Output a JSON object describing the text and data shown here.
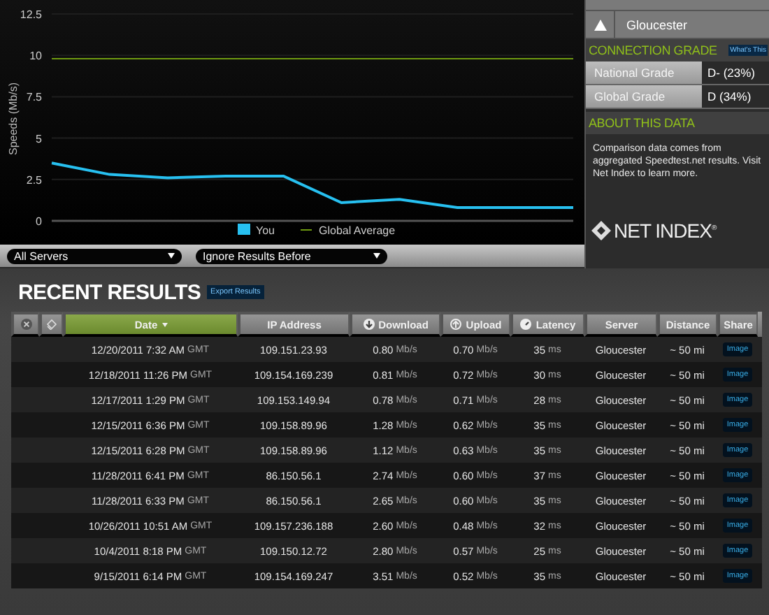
{
  "chart": {
    "chart_data": {
      "type": "line",
      "ylabel": "Speeds (Mb/s)",
      "yticks": [
        0,
        2.5,
        5,
        7.5,
        10,
        12.5
      ],
      "ylim": [
        0,
        12.5
      ],
      "grid": true,
      "legend": true,
      "series": [
        {
          "name": "You",
          "color": "#27c0f0",
          "values": [
            3.5,
            2.8,
            2.6,
            2.7,
            2.7,
            1.1,
            1.3,
            0.8,
            0.8,
            0.8
          ]
        },
        {
          "name": "Global Average",
          "color": "#6e9a10",
          "values": [
            9.8,
            9.8,
            9.8,
            9.8,
            9.8,
            9.8,
            9.8,
            9.8,
            9.8,
            9.8
          ]
        }
      ]
    }
  },
  "filters": [
    {
      "value": "All Servers"
    },
    {
      "value": "Ignore Results Before"
    }
  ],
  "side_panel": {
    "server": "Gloucester",
    "connection_grade": {
      "title": "CONNECTION GRADE",
      "help": "What's This",
      "grades": [
        {
          "label": "National Grade",
          "value": "D- (23%)"
        },
        {
          "label": "Global Grade",
          "value": "D (34%)"
        }
      ]
    },
    "about": {
      "title": "ABOUT THIS DATA",
      "text": "Comparison data comes from aggregated Speedtest.net results. Visit Net Index to learn more."
    },
    "logo": {
      "text": "NET INDEX",
      "mark": "®"
    }
  },
  "recent_results": {
    "title": "RECENT RESULTS",
    "export": "Export Results",
    "columns": [
      {
        "kind": "delete",
        "selected": false
      },
      {
        "kind": "tag",
        "selected": false
      },
      {
        "kind": "sort",
        "label": "Date",
        "selected": true
      },
      {
        "kind": "text",
        "label": "IP Address",
        "selected": false
      },
      {
        "kind": "download",
        "label": "Download",
        "selected": false
      },
      {
        "kind": "upload",
        "label": "Upload",
        "selected": false
      },
      {
        "kind": "latency",
        "label": "Latency",
        "selected": false
      },
      {
        "kind": "text",
        "label": "Server",
        "selected": false
      },
      {
        "kind": "text",
        "label": "Distance",
        "selected": false
      },
      {
        "kind": "text",
        "label": "Share",
        "selected": false
      }
    ],
    "rows": [
      {
        "date": "12/20/2011 7:32 AM",
        "zone": "GMT",
        "ip": "109.151.23.93",
        "download": "0.80",
        "download_unit": "Mb/s",
        "upload": "0.70",
        "upload_unit": "Mb/s",
        "latency": "35",
        "latency_unit": "ms",
        "server": "Gloucester",
        "distance": "~ 50 mi",
        "share": "Image"
      },
      {
        "date": "12/18/2011 11:26 PM",
        "zone": "GMT",
        "ip": "109.154.169.239",
        "download": "0.81",
        "download_unit": "Mb/s",
        "upload": "0.72",
        "upload_unit": "Mb/s",
        "latency": "30",
        "latency_unit": "ms",
        "server": "Gloucester",
        "distance": "~ 50 mi",
        "share": "Image"
      },
      {
        "date": "12/17/2011 1:29 PM",
        "zone": "GMT",
        "ip": "109.153.149.94",
        "download": "0.78",
        "download_unit": "Mb/s",
        "upload": "0.71",
        "upload_unit": "Mb/s",
        "latency": "28",
        "latency_unit": "ms",
        "server": "Gloucester",
        "distance": "~ 50 mi",
        "share": "Image"
      },
      {
        "date": "12/15/2011 6:36 PM",
        "zone": "GMT",
        "ip": "109.158.89.96",
        "download": "1.28",
        "download_unit": "Mb/s",
        "upload": "0.62",
        "upload_unit": "Mb/s",
        "latency": "35",
        "latency_unit": "ms",
        "server": "Gloucester",
        "distance": "~ 50 mi",
        "share": "Image"
      },
      {
        "date": "12/15/2011 6:28 PM",
        "zone": "GMT",
        "ip": "109.158.89.96",
        "download": "1.12",
        "download_unit": "Mb/s",
        "upload": "0.63",
        "upload_unit": "Mb/s",
        "latency": "35",
        "latency_unit": "ms",
        "server": "Gloucester",
        "distance": "~ 50 mi",
        "share": "Image"
      },
      {
        "date": "11/28/2011 6:41 PM",
        "zone": "GMT",
        "ip": "86.150.56.1",
        "download": "2.74",
        "download_unit": "Mb/s",
        "upload": "0.60",
        "upload_unit": "Mb/s",
        "latency": "37",
        "latency_unit": "ms",
        "server": "Gloucester",
        "distance": "~ 50 mi",
        "share": "Image"
      },
      {
        "date": "11/28/2011 6:33 PM",
        "zone": "GMT",
        "ip": "86.150.56.1",
        "download": "2.65",
        "download_unit": "Mb/s",
        "upload": "0.60",
        "upload_unit": "Mb/s",
        "latency": "35",
        "latency_unit": "ms",
        "server": "Gloucester",
        "distance": "~ 50 mi",
        "share": "Image"
      },
      {
        "date": "10/26/2011 10:51 AM",
        "zone": "GMT",
        "ip": "109.157.236.188",
        "download": "2.60",
        "download_unit": "Mb/s",
        "upload": "0.48",
        "upload_unit": "Mb/s",
        "latency": "32",
        "latency_unit": "ms",
        "server": "Gloucester",
        "distance": "~ 50 mi",
        "share": "Image"
      },
      {
        "date": "10/4/2011 8:18 PM",
        "zone": "GMT",
        "ip": "109.150.12.72",
        "download": "2.80",
        "download_unit": "Mb/s",
        "upload": "0.57",
        "upload_unit": "Mb/s",
        "latency": "25",
        "latency_unit": "ms",
        "server": "Gloucester",
        "distance": "~ 50 mi",
        "share": "Image"
      },
      {
        "date": "9/15/2011 6:14 PM",
        "zone": "GMT",
        "ip": "109.154.169.247",
        "download": "3.51",
        "download_unit": "Mb/s",
        "upload": "0.52",
        "upload_unit": "Mb/s",
        "latency": "35",
        "latency_unit": "ms",
        "server": "Gloucester",
        "distance": "~ 50 mi",
        "share": "Image"
      }
    ]
  }
}
